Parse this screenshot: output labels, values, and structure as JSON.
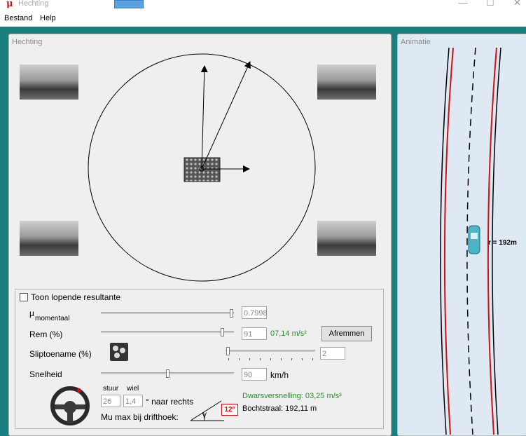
{
  "window": {
    "title": "Hechting"
  },
  "menu": {
    "items": [
      "Bestand",
      "Help"
    ]
  },
  "left_panel": {
    "title": "Hechting"
  },
  "right_panel": {
    "title": "Animatie",
    "radius_label": "r = 192m"
  },
  "controls": {
    "show_resultant_label": "Toon lopende resultante",
    "show_resultant_checked": false,
    "mu_symbol": "μ",
    "mu_sub": "momentaal",
    "mu_value": "0.7998",
    "mu_level": 0.98,
    "rem_label": "Rem (%)",
    "rem_value": "91",
    "rem_level": 0.91,
    "rem_decel": "07,14 m/s²",
    "brake_button": "Afremmen",
    "slip_label": "Sliptoename (%)",
    "slip_value": "2",
    "slip_level": 0.02,
    "speed_label": "Snelheid",
    "speed_value": "90",
    "speed_unit": "km/h",
    "speed_level": 0.5,
    "stuur_label": "stuur",
    "wiel_label": "wiel",
    "stuur_value": "26",
    "wiel_value": "1,4",
    "right_label": "° naar rechts",
    "mu_max_label": "Mu max bij drifthoek:",
    "lateral_acc": "Dwarsversnelling: 03,25 m/s²",
    "curve_radius": "Bochtstraal: 192,11 m",
    "angle_gamma": "γ",
    "angle_value": "12°"
  },
  "colors": {
    "accent": "#2a8a2a",
    "road_red": "#d01010",
    "background": "#1a7f7f"
  }
}
